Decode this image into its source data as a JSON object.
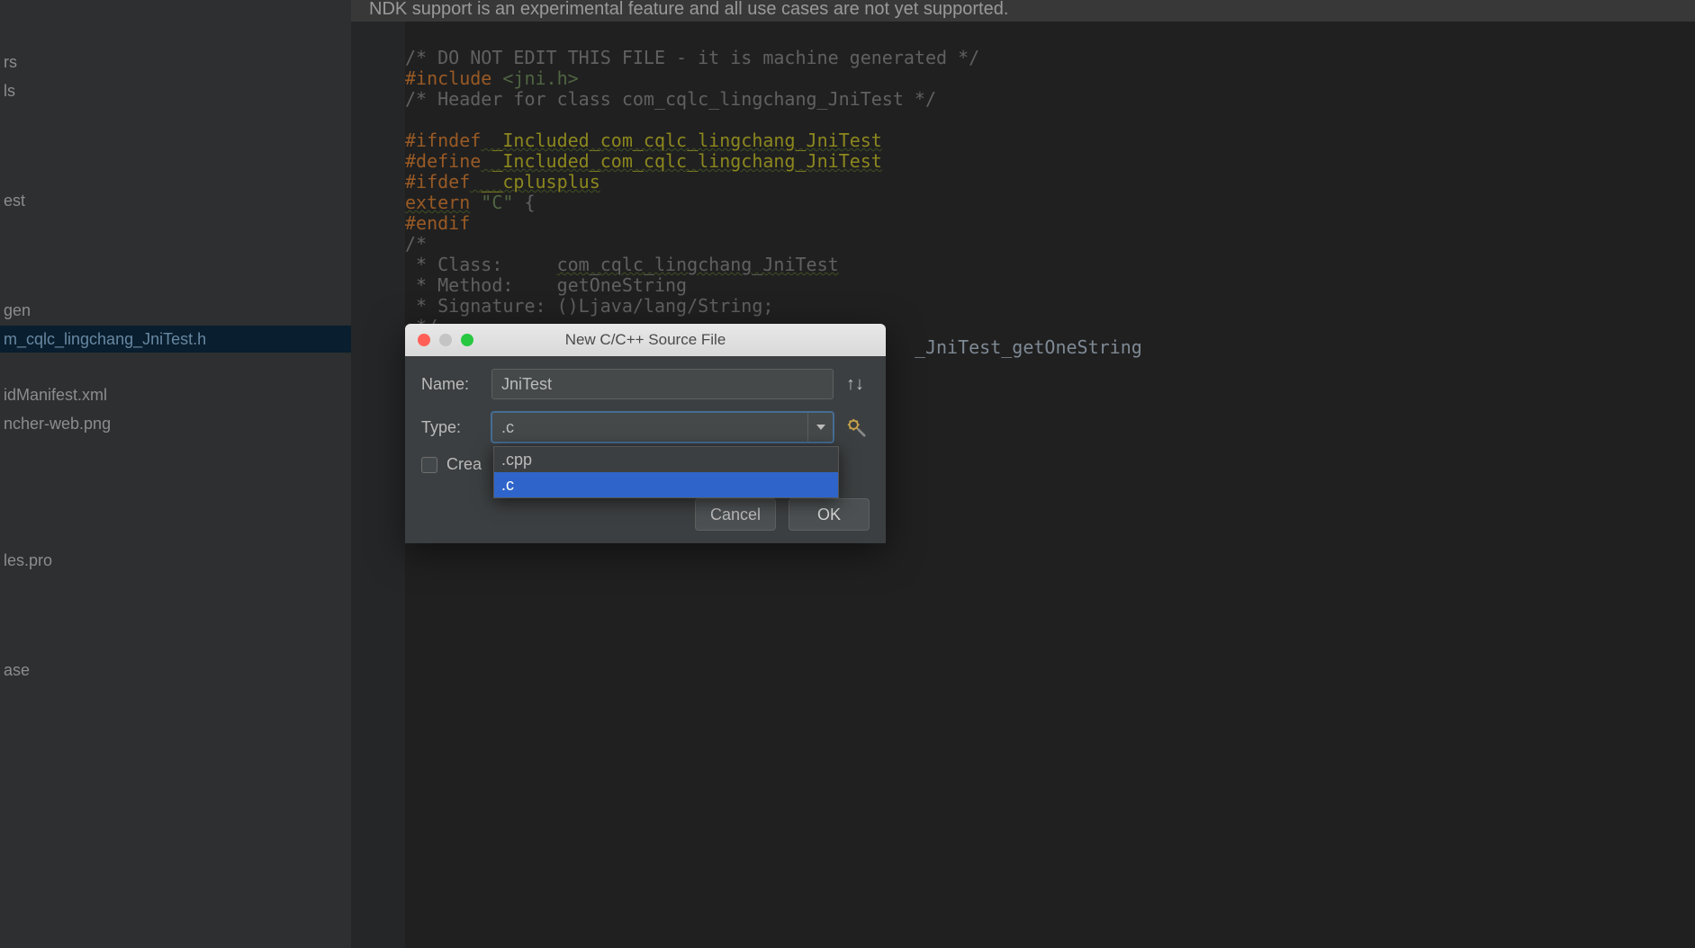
{
  "banner": "NDK support is an experimental feature and all use cases are not yet supported.",
  "sidebar": {
    "items": [
      "rs",
      "ls",
      "",
      "",
      "",
      "est",
      "",
      "",
      "",
      "gen",
      "m_cqlc_lingchang_JniTest.h",
      "",
      "idManifest.xml",
      "ncher-web.png",
      "",
      "",
      "",
      "",
      "les.pro",
      "",
      "",
      "",
      "ase"
    ],
    "selected_index": 10
  },
  "code": {
    "l1a": "/* DO NOT EDIT THIS FILE - it is machine generated */",
    "l2a": "#include",
    "l2b": " <jni.h>",
    "l3a": "/* Header for class com_cqlc_lingchang_JniTest */",
    "l4": "",
    "l5a": "#ifndef",
    "l5b": " _Included_com_cqlc_lingchang_JniTest",
    "l6a": "#define",
    "l6b": " _Included_com_cqlc_lingchang_JniTest",
    "l7a": "#ifdef",
    "l7b": " __cplusplus",
    "l8a": "extern",
    "l8b": " \"C\" ",
    "l8c": "{",
    "l9a": "#endif",
    "l10a": "/*",
    "l11a": " * Class:     ",
    "l11b": "com_cqlc_lingchang_JniTest",
    "l12a": " * Method:    getOneString",
    "l13a": " * Signature: ()Ljava/lang/String;",
    "l14a": " */",
    "l15tail": "_JniTest_getOneString"
  },
  "dialog": {
    "title": "New C/C++ Source File",
    "name_label": "Name:",
    "name_value": "JniTest",
    "type_label": "Type:",
    "type_value": ".c",
    "checkbox_label": "Crea",
    "dropdown": {
      "options": [
        ".cpp",
        ".c"
      ],
      "selected_index": 1
    },
    "cancel": "Cancel",
    "ok": "OK"
  }
}
